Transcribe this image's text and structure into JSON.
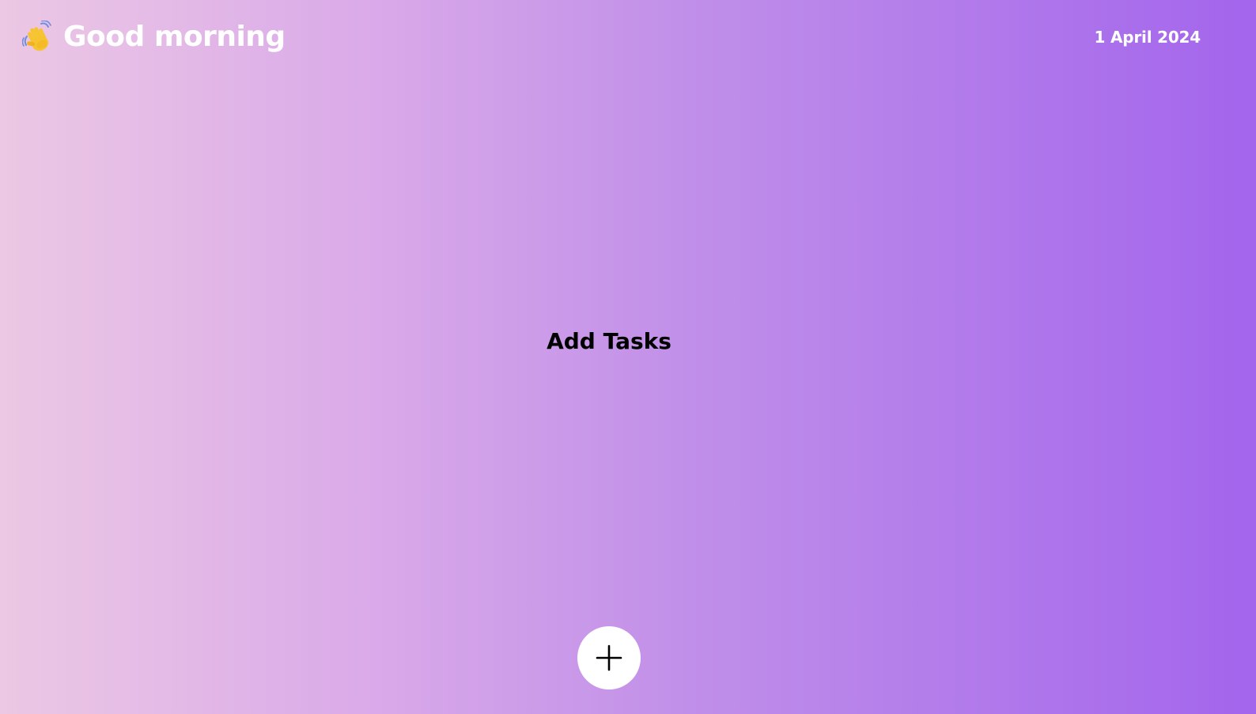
{
  "header": {
    "greeting_icon": "waving-hand-icon",
    "greeting": "Good morning",
    "date": "1 April 2024"
  },
  "main": {
    "empty_message": "Add Tasks"
  },
  "fab": {
    "icon": "plus-icon",
    "background": "#ffffff"
  },
  "colors": {
    "gradient_start": "#ecc8e4",
    "gradient_end": "#a365ec",
    "header_text": "#ffffff",
    "body_text": "#000000"
  }
}
